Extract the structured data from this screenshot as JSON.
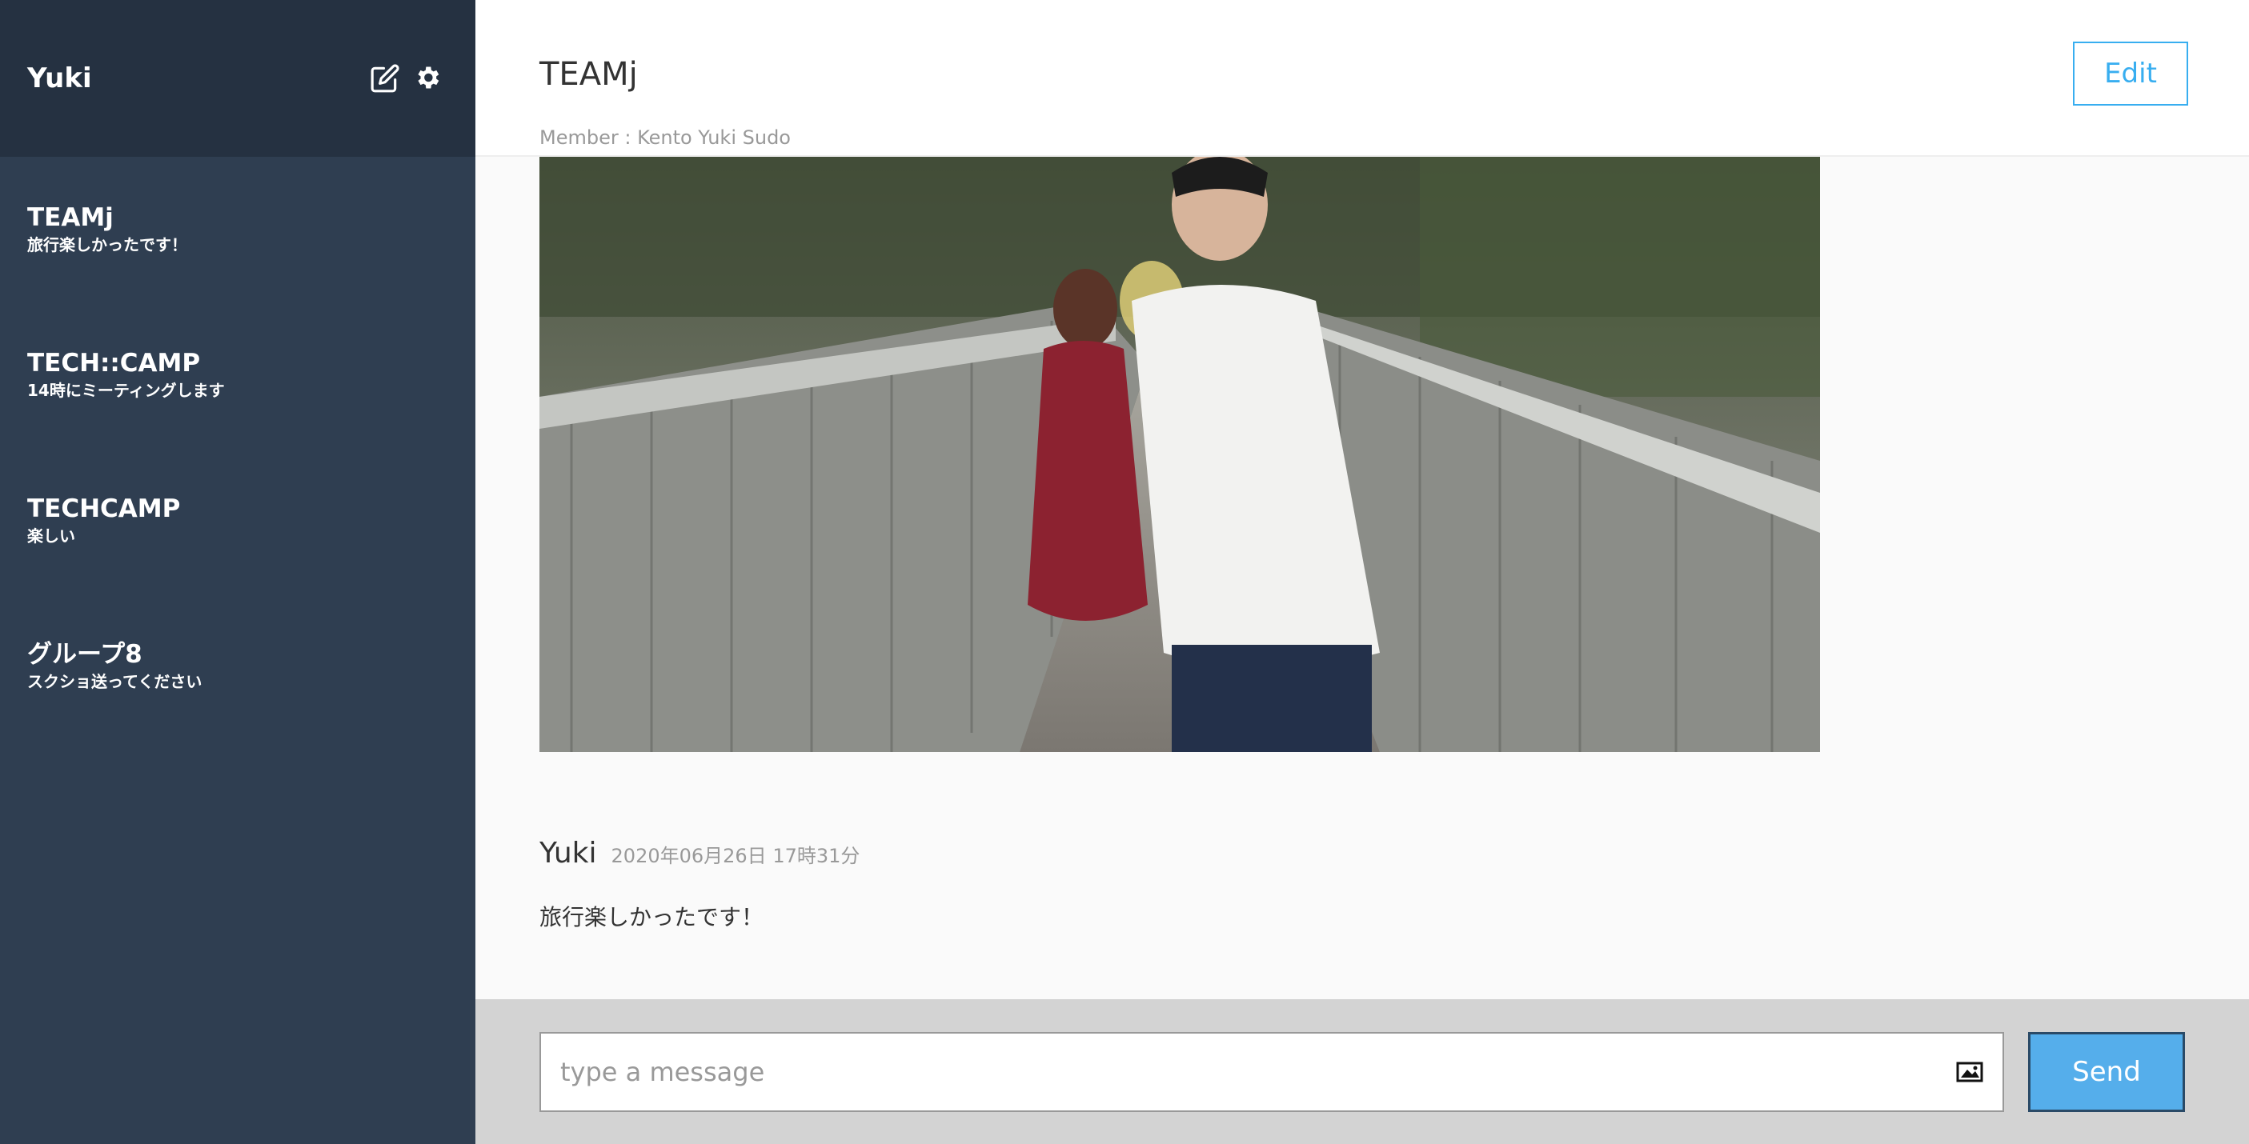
{
  "sidebar": {
    "user_name": "Yuki",
    "groups": [
      {
        "name": "TEAMj",
        "last_message": "旅行楽しかったです！"
      },
      {
        "name": "TECH::CAMP",
        "last_message": "14時にミーティングします"
      },
      {
        "name": "TECHCAMP",
        "last_message": "楽しい"
      },
      {
        "name": "グループ8",
        "last_message": "スクショ送ってください"
      }
    ],
    "icons": [
      "edit-icon",
      "gear-icon"
    ]
  },
  "header": {
    "title": "TEAMj",
    "members": "Member : Kento Yuki Sudo",
    "edit_label": "Edit"
  },
  "message": {
    "user": "Yuki",
    "date": "2020年06月26日 17時31分",
    "text": "旅行楽しかったです！"
  },
  "form": {
    "placeholder": "type a message",
    "send_label": "Send",
    "image_icon": "image-icon"
  },
  "colors": {
    "sidebar_bg": "#2f3e51",
    "sidebar_header_bg": "#253141",
    "accent": "#38aef0",
    "send_bg": "#55aeeb",
    "form_bg": "#d3d3d3"
  }
}
